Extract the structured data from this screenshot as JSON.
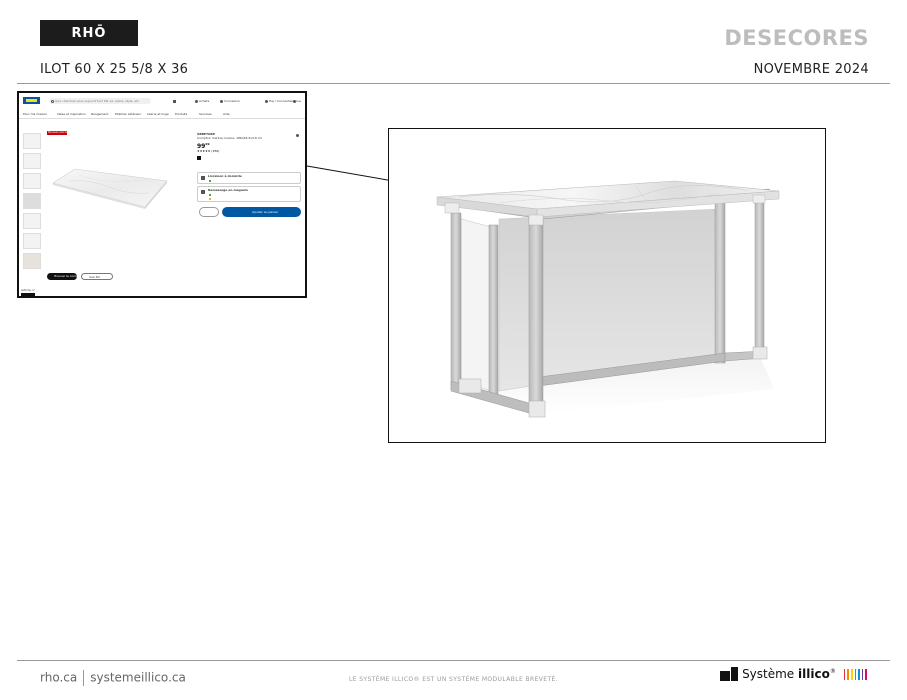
{
  "header": {
    "logo": "RHŌ",
    "client": "DESECORES",
    "title": "ILOT 60 X 25 5/8 X 36",
    "date": "NOVEMBRE 2024"
  },
  "footer": {
    "link1": "rho.ca",
    "link2": "systemeillico.ca",
    "tagline": "LE SYSTÈME ILLICO® EST UN SYSTÈME MODULABLE BREVETÉ.",
    "brand_word1": "Système",
    "brand_word2": "illico",
    "brand_mark": "®",
    "brand_bar_colors": [
      "#e4322b",
      "#f39200",
      "#ffd500",
      "#3aaa35",
      "#0095db",
      "#6a3d98",
      "#e5007d"
    ]
  },
  "web_screenshot": {
    "brand_colors": {
      "blue": "#0058a3",
      "yellow": "#ffda1a",
      "sale_red": "#cc0008"
    },
    "search_placeholder": "Que cherchez-vous aujourd'hui? Par ex. pièce, style, etc.",
    "nav": [
      "Achats",
      "Connexion",
      "Hej ! Connectez-vous"
    ],
    "tabs": [
      "Pour ma maison",
      "Idées et inspiration",
      "Rangement",
      "Mobilier extérieur",
      "Literie et linge",
      "Produits",
      "Services",
      "Aide"
    ],
    "badge": "Nouveau plus bas",
    "product_name": "ÄBBETORP",
    "product_desc": "Comptoir marbre cuisine, 186x63,5x3,8 cm",
    "price": "99",
    "price_cents": "99",
    "rating_count": "(256)",
    "delivery_heading": "Livraison à domicile",
    "store_heading": "Ramassage en magasin",
    "add_button": "Ajouter au panier",
    "chip_primary": "Trouver le comptoir",
    "chip_secondary": "Vue 3D",
    "footer_note": "Article n°"
  }
}
